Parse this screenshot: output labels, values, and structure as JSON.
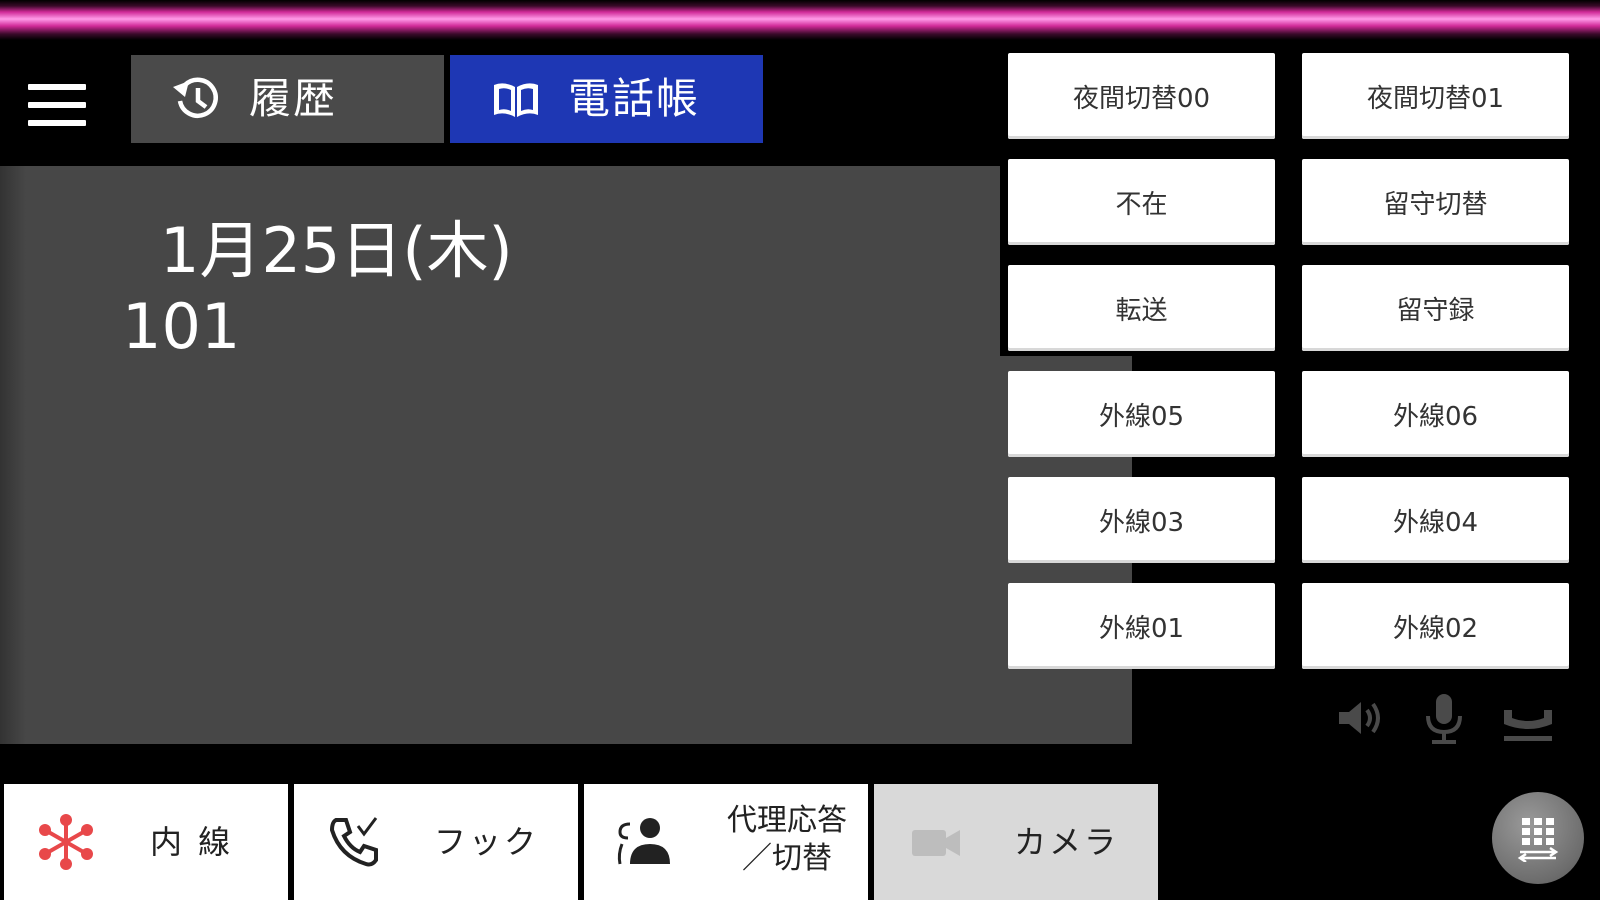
{
  "header": {
    "tabs": [
      {
        "label": "履歴",
        "icon": "history-icon",
        "active": false
      },
      {
        "label": "電話帳",
        "icon": "phonebook-icon",
        "active": true
      }
    ]
  },
  "main": {
    "date": "1月25日(木)",
    "extension": "101"
  },
  "function_keys": [
    [
      "夜間切替00",
      "夜間切替01"
    ],
    [
      "不在",
      "留守切替"
    ],
    [
      "転送",
      "留守録"
    ],
    [
      "外線05",
      "外線06"
    ],
    [
      "外線03",
      "外線04"
    ],
    [
      "外線01",
      "外線02"
    ]
  ],
  "status_icons": [
    "speaker-icon",
    "microphone-icon",
    "handset-icon"
  ],
  "bottom_bar": {
    "intercom": "内 線",
    "hook": "フック",
    "proxy_line1": "代理応答",
    "proxy_line2": "／切替",
    "camera": "カメラ"
  },
  "colors": {
    "active_tab": "#1e37b4",
    "inactive_tab": "#4a4a4a",
    "panel": "#474747",
    "accent_top": "#ff9ae8",
    "intercom_icon": "#e8484a"
  }
}
